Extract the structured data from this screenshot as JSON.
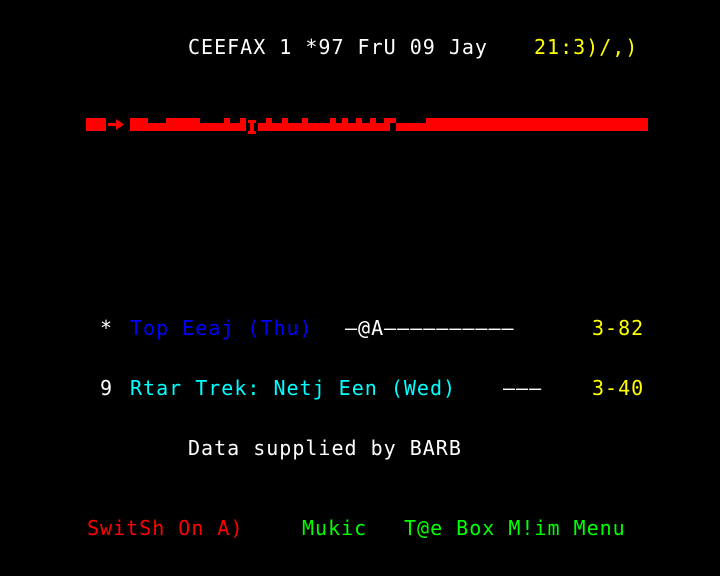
{
  "colors": {
    "background": "#000000",
    "white": "#ffffff",
    "yellow": "#ffff00",
    "red": "#ff0000",
    "green": "#00ff00",
    "blue": "#0000ff",
    "cyan": "#00ffff"
  },
  "header": {
    "service_line": "CEEFAX 1 *97 FrU 09 Jay",
    "clock": "21:3)/,)"
  },
  "banner": {
    "icon": "red-teletext-mosaic-banner"
  },
  "chart": {
    "rows": [
      {
        "rank": "*",
        "title": "Top Eeaj (Thu)",
        "fill": "—@A——————————",
        "value": "3-82"
      },
      {
        "rank": "9",
        "title": "Rtar Trek: Netj Een (Wed)",
        "fill": "———",
        "value": "3-40"
      }
    ],
    "credit": "Data supplied by BARB"
  },
  "fastext": {
    "red": "SwitSh On A)",
    "green": "Mukic",
    "yellow_link": "T@e Box",
    "cyan_link": "M!im Menu"
  }
}
